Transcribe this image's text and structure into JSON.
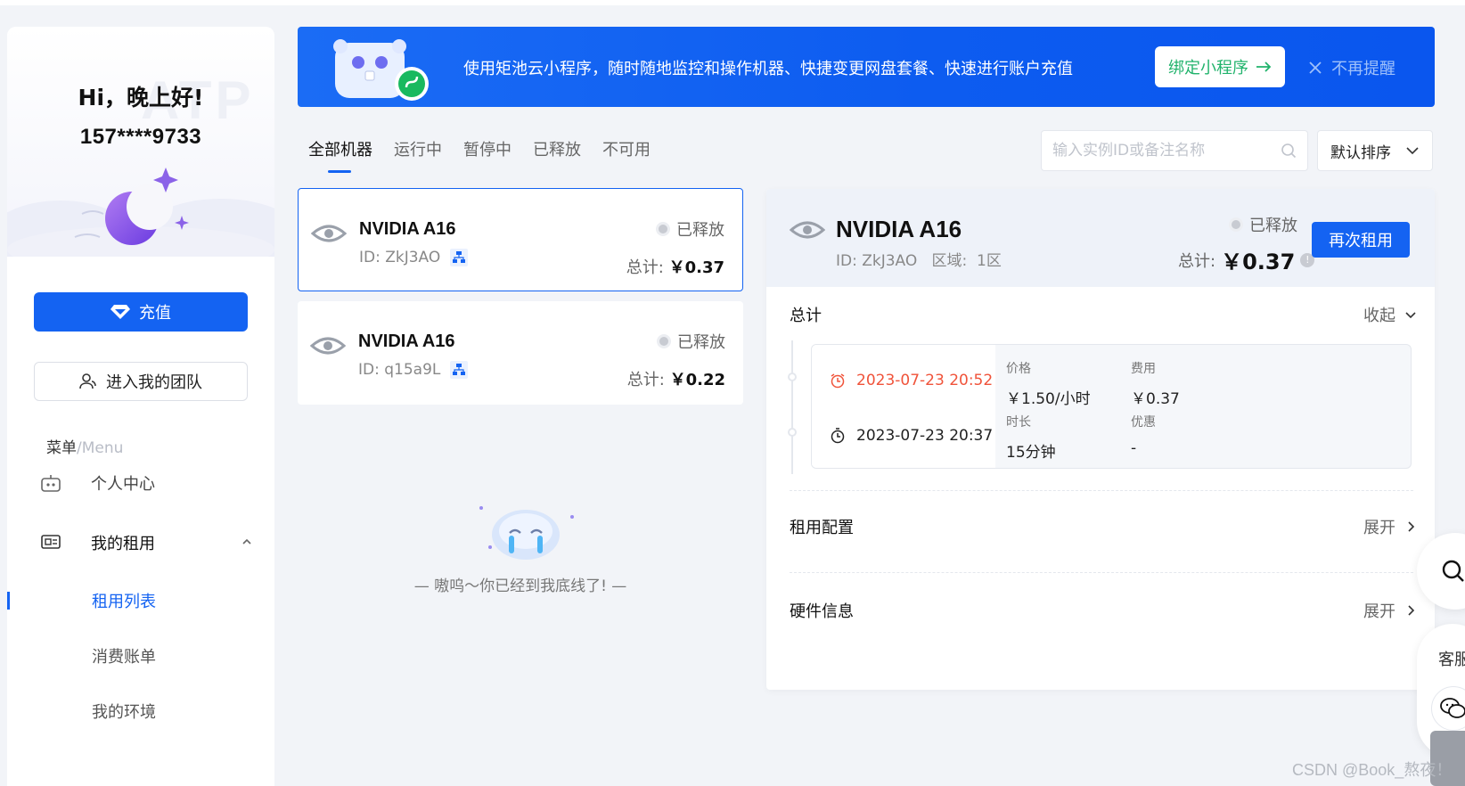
{
  "sidebar": {
    "greeting": "Hi，晚上好!",
    "phone": "157****9733",
    "recharge_label": "充值",
    "team_label": "进入我的团队",
    "menu_title": "菜单",
    "menu_subtitle": "/Menu",
    "nav": [
      {
        "label": "个人中心",
        "icon": "robot-icon"
      },
      {
        "label": "我的租用",
        "icon": "rental-card-icon",
        "expanded": true
      }
    ],
    "sub_items": [
      {
        "label": "租用列表",
        "active": true
      },
      {
        "label": "消费账单",
        "active": false
      },
      {
        "label": "我的环境",
        "active": false
      }
    ]
  },
  "banner": {
    "text": "使用矩池云小程序，随时随地监控和操作机器、快捷变更网盘套餐、快速进行账户充值",
    "bind_label": "绑定小程序",
    "dismiss_label": "不再提醒"
  },
  "tabs": [
    {
      "label": "全部机器",
      "active": true
    },
    {
      "label": "运行中",
      "active": false
    },
    {
      "label": "暂停中",
      "active": false
    },
    {
      "label": "已释放",
      "active": false
    },
    {
      "label": "不可用",
      "active": false
    }
  ],
  "search": {
    "placeholder": "输入实例ID或备注名称",
    "value": ""
  },
  "sort": {
    "selected": "默认排序"
  },
  "machines": [
    {
      "name": "NVIDIA A16",
      "id": "ID: ZkJ3AO",
      "status": "已释放",
      "total_label": "总计: ",
      "total": "￥0.37",
      "selected": true
    },
    {
      "name": "NVIDIA A16",
      "id": "ID: q15a9L",
      "status": "已释放",
      "total_label": "总计: ",
      "total": "￥0.22",
      "selected": false
    }
  ],
  "empty_text": "— 嗷呜～你已经到我底线了! —",
  "detail": {
    "name": "NVIDIA A16",
    "meta": "ID: ZkJ3AO   区域:  1区",
    "status": "已释放",
    "total_label": "总计: ",
    "total": "￥0.37",
    "rent_again_label": "再次租用",
    "summary_title": "总计",
    "collapse_label": "收起",
    "end_time": "2023-07-23 20:52",
    "start_time": "2023-07-23 20:37",
    "price_label": "价格",
    "price_value": "￥1.50/小时",
    "fee_label": "费用",
    "fee_value": "￥0.37",
    "duration_label": "时长",
    "duration_value": "15分钟",
    "discount_label": "优惠",
    "discount_value": "-",
    "config_title": "租用配置",
    "hardware_title": "硬件信息",
    "expand_label": "展开"
  },
  "floating": {
    "service_label": "客服"
  },
  "watermark": "CSDN @Book_熬夜！",
  "colors": {
    "accent": "#1463f2",
    "success": "#21b36c",
    "danger": "#f0533a"
  }
}
